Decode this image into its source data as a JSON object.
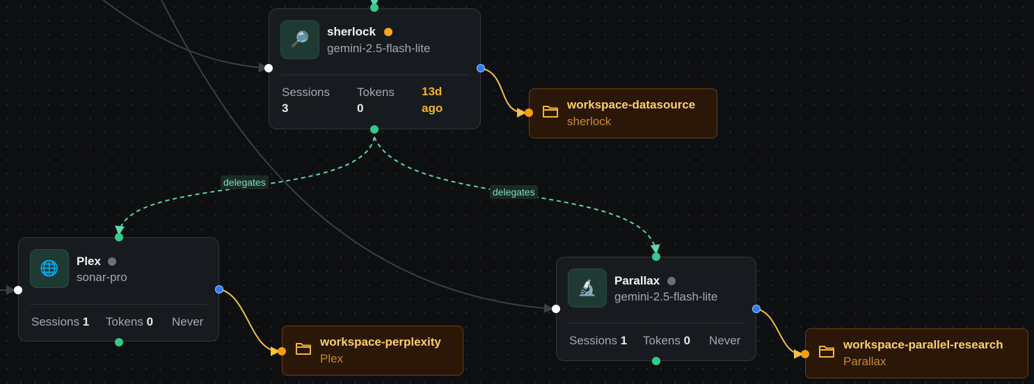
{
  "agents": {
    "sherlock": {
      "name": "sherlock",
      "model": "gemini-2.5-flash-lite",
      "status_color": "#f5a623",
      "icon": "magnifier-icon",
      "sessions_label": "Sessions",
      "sessions_value": "3",
      "tokens_label": "Tokens",
      "tokens_value": "0",
      "last_active_line1": "13d",
      "last_active_line2": "ago"
    },
    "plex": {
      "name": "Plex",
      "model": "sonar-pro",
      "status_color": "#6b7078",
      "icon": "globe-icon",
      "sessions_label": "Sessions",
      "sessions_value": "1",
      "tokens_label": "Tokens",
      "tokens_value": "0",
      "last_active": "Never"
    },
    "parallax": {
      "name": "Parallax",
      "model": "gemini-2.5-flash-lite",
      "status_color": "#6b7078",
      "icon": "microscope-icon",
      "sessions_label": "Sessions",
      "sessions_value": "1",
      "tokens_label": "Tokens",
      "tokens_value": "0",
      "last_active": "Never"
    }
  },
  "workspaces": {
    "datasource": {
      "title": "workspace-datasource",
      "owner": "sherlock"
    },
    "perplexity": {
      "title": "workspace-perplexity",
      "owner": "Plex"
    },
    "parallel": {
      "title": "workspace-parallel-research",
      "owner": "Parallax"
    }
  },
  "edges": {
    "delegate_label_1": "delegates",
    "delegate_label_2": "delegates"
  },
  "colors": {
    "canvas_bg": "#0e0f11",
    "node_bg": "#171b1f",
    "delegate_edge": "#5fd6ad",
    "workspace_edge": "#f5c242",
    "plain_edge": "#3a3f48",
    "workspace_title": "#ffcf6b",
    "workspace_owner": "#c98a2b",
    "active_time": "#f0b429"
  }
}
